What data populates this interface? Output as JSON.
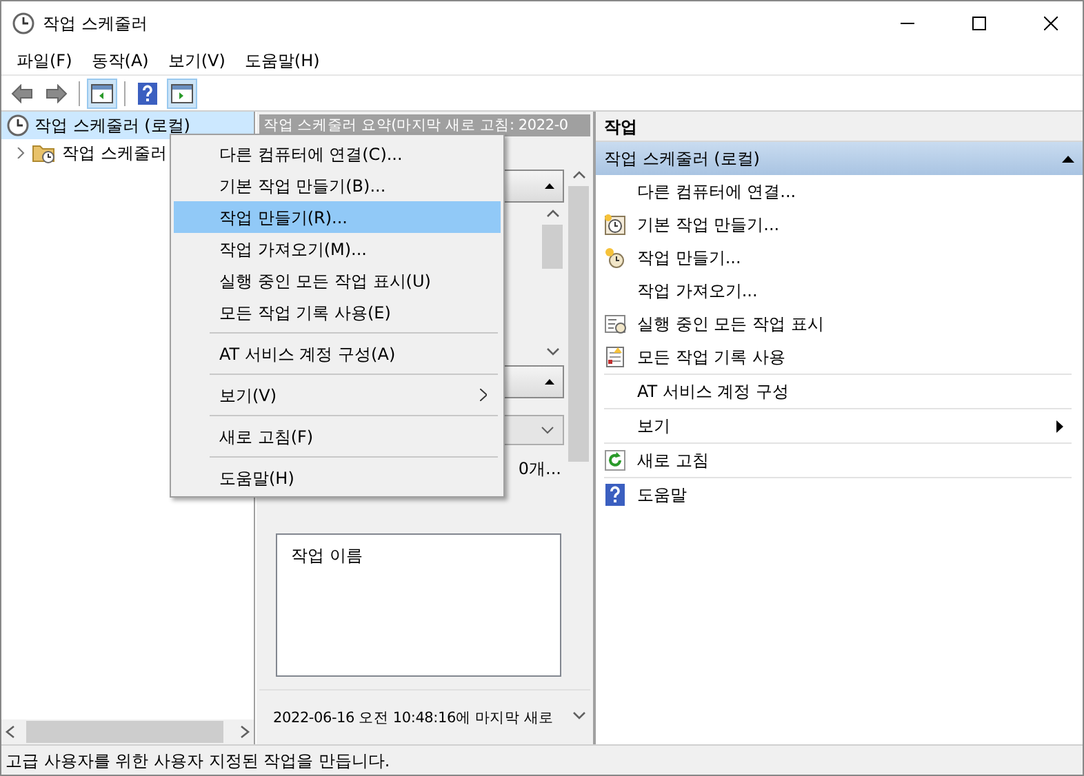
{
  "window": {
    "title": "작업 스케줄러"
  },
  "menu_bar": [
    {
      "label": "파일(F)"
    },
    {
      "label": "동작(A)"
    },
    {
      "label": "보기(V)"
    },
    {
      "label": "도움말(H)"
    }
  ],
  "tree": [
    {
      "label": "작업 스케줄러 (로컬)",
      "selected": true,
      "children": [
        {
          "label": "작업 스케줄러",
          "selected": false,
          "expanded": false
        }
      ]
    }
  ],
  "summary": {
    "header": "작업 스케줄러 요약(마지막 새로 고침: 2022-0",
    "status_fragment": "0개...",
    "task_list_header": "작업 이름",
    "footer": "2022-06-16 오전 10:48:16에 마지막 새로"
  },
  "actions": {
    "title": "작업",
    "group": {
      "label": "작업 스케줄러 (로컬)",
      "expanded": true
    },
    "items": [
      {
        "label": "다른 컴퓨터에 연결...",
        "kind": "plain",
        "separator_before": false
      },
      {
        "label": "기본 작업 만들기...",
        "kind": "basic-task",
        "separator_before": false
      },
      {
        "label": "작업 만들기...",
        "kind": "create-task",
        "separator_before": false
      },
      {
        "label": "작업 가져오기...",
        "kind": "plain",
        "separator_before": false
      },
      {
        "label": "실행 중인 모든 작업 표시",
        "kind": "running",
        "separator_before": false
      },
      {
        "label": "모든 작업 기록 사용",
        "kind": "history",
        "separator_before": false
      },
      {
        "label": "AT 서비스 계정 구성",
        "kind": "plain",
        "separator_before": true
      },
      {
        "label": "보기",
        "kind": "submenu",
        "separator_before": true
      },
      {
        "label": "새로 고침",
        "kind": "refresh",
        "separator_before": true
      },
      {
        "label": "도움말",
        "kind": "help",
        "separator_before": true
      }
    ]
  },
  "context_menu": [
    {
      "label": "다른 컴퓨터에 연결(C)...",
      "selected": false,
      "submenu": false,
      "separator_before": false
    },
    {
      "label": "기본 작업 만들기(B)...",
      "selected": false,
      "submenu": false,
      "separator_before": false
    },
    {
      "label": "작업 만들기(R)...",
      "selected": true,
      "submenu": false,
      "separator_before": false
    },
    {
      "label": "작업 가져오기(M)...",
      "selected": false,
      "submenu": false,
      "separator_before": false
    },
    {
      "label": "실행 중인 모든 작업 표시(U)",
      "selected": false,
      "submenu": false,
      "separator_before": false
    },
    {
      "label": "모든 작업 기록 사용(E)",
      "selected": false,
      "submenu": false,
      "separator_before": false
    },
    {
      "label": "AT 서비스 계정 구성(A)",
      "selected": false,
      "submenu": false,
      "separator_before": true
    },
    {
      "label": "보기(V)",
      "selected": false,
      "submenu": true,
      "separator_before": true
    },
    {
      "label": "새로 고침(F)",
      "selected": false,
      "submenu": false,
      "separator_before": true
    },
    {
      "label": "도움말(H)",
      "selected": false,
      "submenu": false,
      "separator_before": true
    }
  ],
  "status_bar": {
    "text": "고급 사용자를 위한 사용자 지정된 작업을 만듭니다."
  }
}
